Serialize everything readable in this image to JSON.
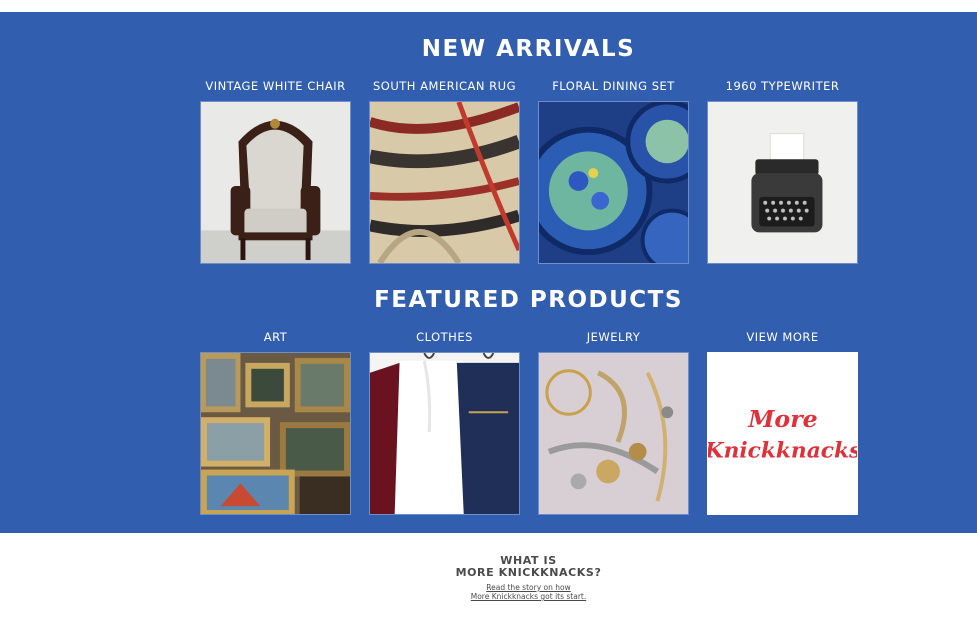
{
  "new_arrivals": {
    "title": "NEW ARRIVALS",
    "items": [
      {
        "label": "VINTAGE WHITE CHAIR"
      },
      {
        "label": "SOUTH AMERICAN RUG"
      },
      {
        "label": "FLORAL DINING SET"
      },
      {
        "label": "1960 TYPEWRITER"
      }
    ]
  },
  "featured": {
    "title": "FEATURED PRODUCTS",
    "items": [
      {
        "label": "ART"
      },
      {
        "label": "CLOTHES"
      },
      {
        "label": "JEWELRY"
      },
      {
        "label": "VIEW MORE",
        "logo_line1": "More",
        "logo_line2": "Knickknacks"
      }
    ]
  },
  "about": {
    "title_line1": "WHAT IS",
    "title_line2": "MORE KNICKKNACKS?",
    "link_line1": "Read the story on how",
    "link_line2": "More Knickknacks got its start."
  },
  "colors": {
    "band": "#325eb0",
    "logo_red": "#e0303a",
    "text_gray": "#4a4a4a"
  }
}
